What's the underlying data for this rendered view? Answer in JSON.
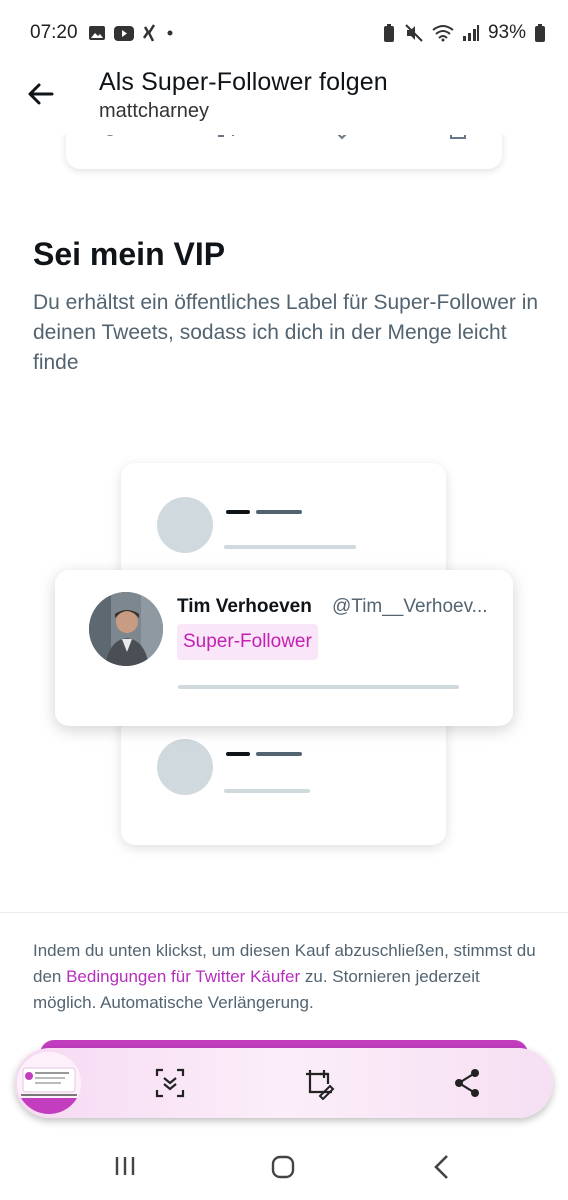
{
  "status": {
    "time": "07:20",
    "battery": "93%"
  },
  "header": {
    "title": "Als Super-Follower folgen",
    "subtitle": "mattcharney"
  },
  "section": {
    "title": "Sei mein VIP",
    "description": "Du erhältst ein öffentliches Label für Super-Follower in deinen Tweets, sodass ich dich in der Menge leicht finde"
  },
  "feature_card": {
    "name": "Tim Verhoeven",
    "handle": "@Tim__Verhoev...",
    "badge": "Super-Follower"
  },
  "terms": {
    "before": "Indem du unten klickst, um diesen Kauf abzuschließen, stimmst du den ",
    "link": "Bedingungen für Twitter Käufer",
    "after": " zu. Stornieren jederzeit möglich. Automatische Verlängerung."
  },
  "colors": {
    "accent": "#c23ebf",
    "badge_bg": "#f9e6f8",
    "badge_text": "#c41fb3",
    "muted": "#536471"
  }
}
